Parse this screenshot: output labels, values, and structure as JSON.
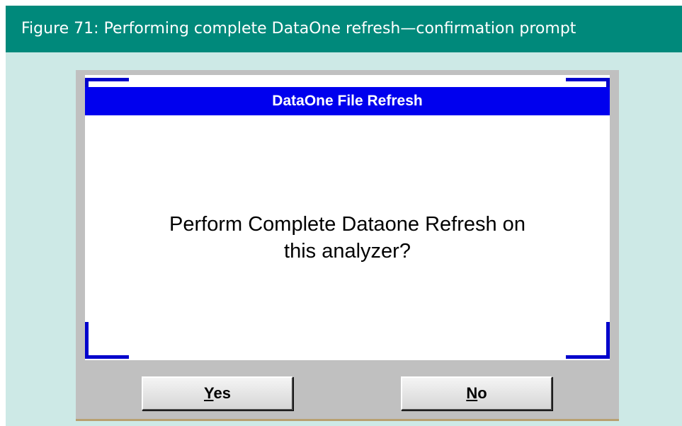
{
  "figure": {
    "caption": "Figure 71: Performing complete DataOne refresh—confirmation prompt"
  },
  "dialog": {
    "title": "DataOne File Refresh",
    "message_line1": "Perform Complete Dataone Refresh on",
    "message_line2": "this analyzer?",
    "buttons": {
      "yes": {
        "mnemonic": "Y",
        "rest": "es"
      },
      "no": {
        "mnemonic": "N",
        "rest": "o"
      }
    }
  },
  "colors": {
    "header_bg": "#00897b",
    "figure_bg": "#cde9e6",
    "title_bar": "#0000ee",
    "corner_accent": "#0000cc",
    "dialog_bg": "#c0c0c0"
  }
}
